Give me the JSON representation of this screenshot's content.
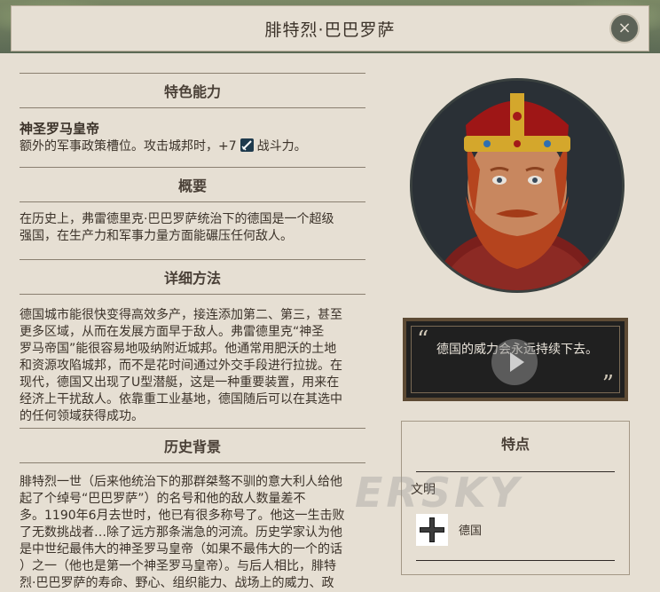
{
  "header": {
    "title": "腓特烈·巴巴罗萨"
  },
  "sections": {
    "ability": {
      "heading": "特色能力",
      "title": "神圣罗马皇帝",
      "desc_before": "额外的军事政策槽位。攻击城邦时，+7",
      "desc_after": "战斗力。"
    },
    "overview": {
      "heading": "概要",
      "lines": [
        "在历史上，弗雷德里克·巴巴罗萨统治下的德国是一个超级",
        "强国，在生产力和军事力量方面能碾压任何敌人。"
      ]
    },
    "details": {
      "heading": "详细方法",
      "lines": [
        "德国城市能很快变得高效多产，接连添加第二、第三，甚至",
        "更多区域，从而在发展方面早于敌人。弗雷德里克“神圣",
        "罗马帝国”能很容易地吸纳附近城邦。他通常用肥沃的土地",
        "和资源攻陷城邦，而不是花时间通过外交手段进行拉拢。在",
        "现代，德国又出现了U型潜艇，这是一种重要装置，用来在",
        "经济上干扰敌人。依靠重工业基地，德国随后可以在其选中",
        "的任何领域获得成功。"
      ]
    },
    "history": {
      "heading": "历史背景",
      "lines": [
        "腓特烈一世（后来他统治下的那群桀骜不驯的意大利人给他",
        "起了个绰号“巴巴罗萨”）的名号和他的敌人数量差不",
        "多。1190年6月去世时，他已有很多称号了。他这一生击败",
        "了无数挑战者…除了远方那条湍急的河流。历史学家认为他",
        "是中世纪最伟大的神圣罗马皇帝（如果不最伟大的一个的话",
        "）之一（他也是第一个神圣罗马皇帝）。与后人相比，腓特",
        "烈·巴巴罗萨的寿命、野心、组织能力、战场上的威力、政"
      ]
    }
  },
  "quote": {
    "text": "德国的威力会永远持续下去。"
  },
  "traits": {
    "title": "特点",
    "civ_label": "文明",
    "civ_name": "德国"
  },
  "watermark": "ERSKY",
  "colors": {
    "background": "#e6dfd3",
    "quote_bg": "#202020",
    "portrait_bg": "#2a3036"
  }
}
